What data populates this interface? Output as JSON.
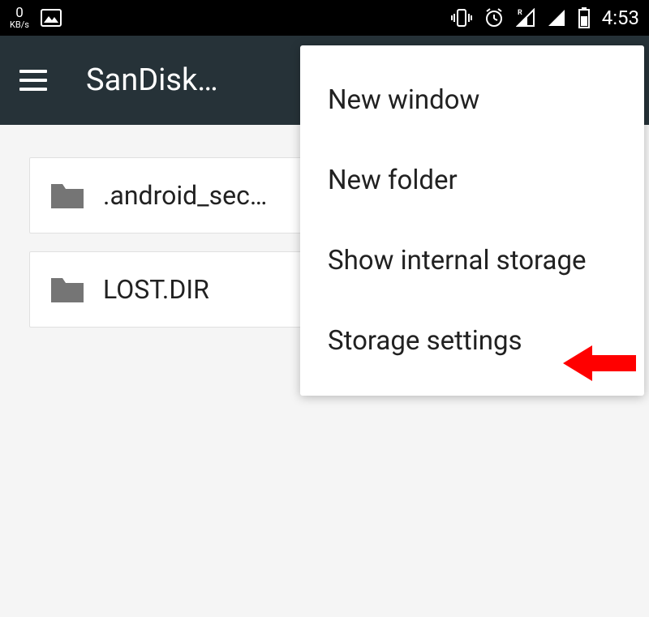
{
  "status_bar": {
    "kbs_value": "0",
    "kbs_unit": "KB/s",
    "time": "4:53"
  },
  "app_bar": {
    "title": "SanDisk…"
  },
  "files": [
    {
      "name": ".android_sec…"
    },
    {
      "name": "LOST.DIR"
    }
  ],
  "menu": {
    "items": [
      {
        "label": "New window"
      },
      {
        "label": "New folder"
      },
      {
        "label": "Show internal storage"
      },
      {
        "label": "Storage settings"
      }
    ]
  },
  "colors": {
    "accent_arrow": "#ff0000"
  }
}
